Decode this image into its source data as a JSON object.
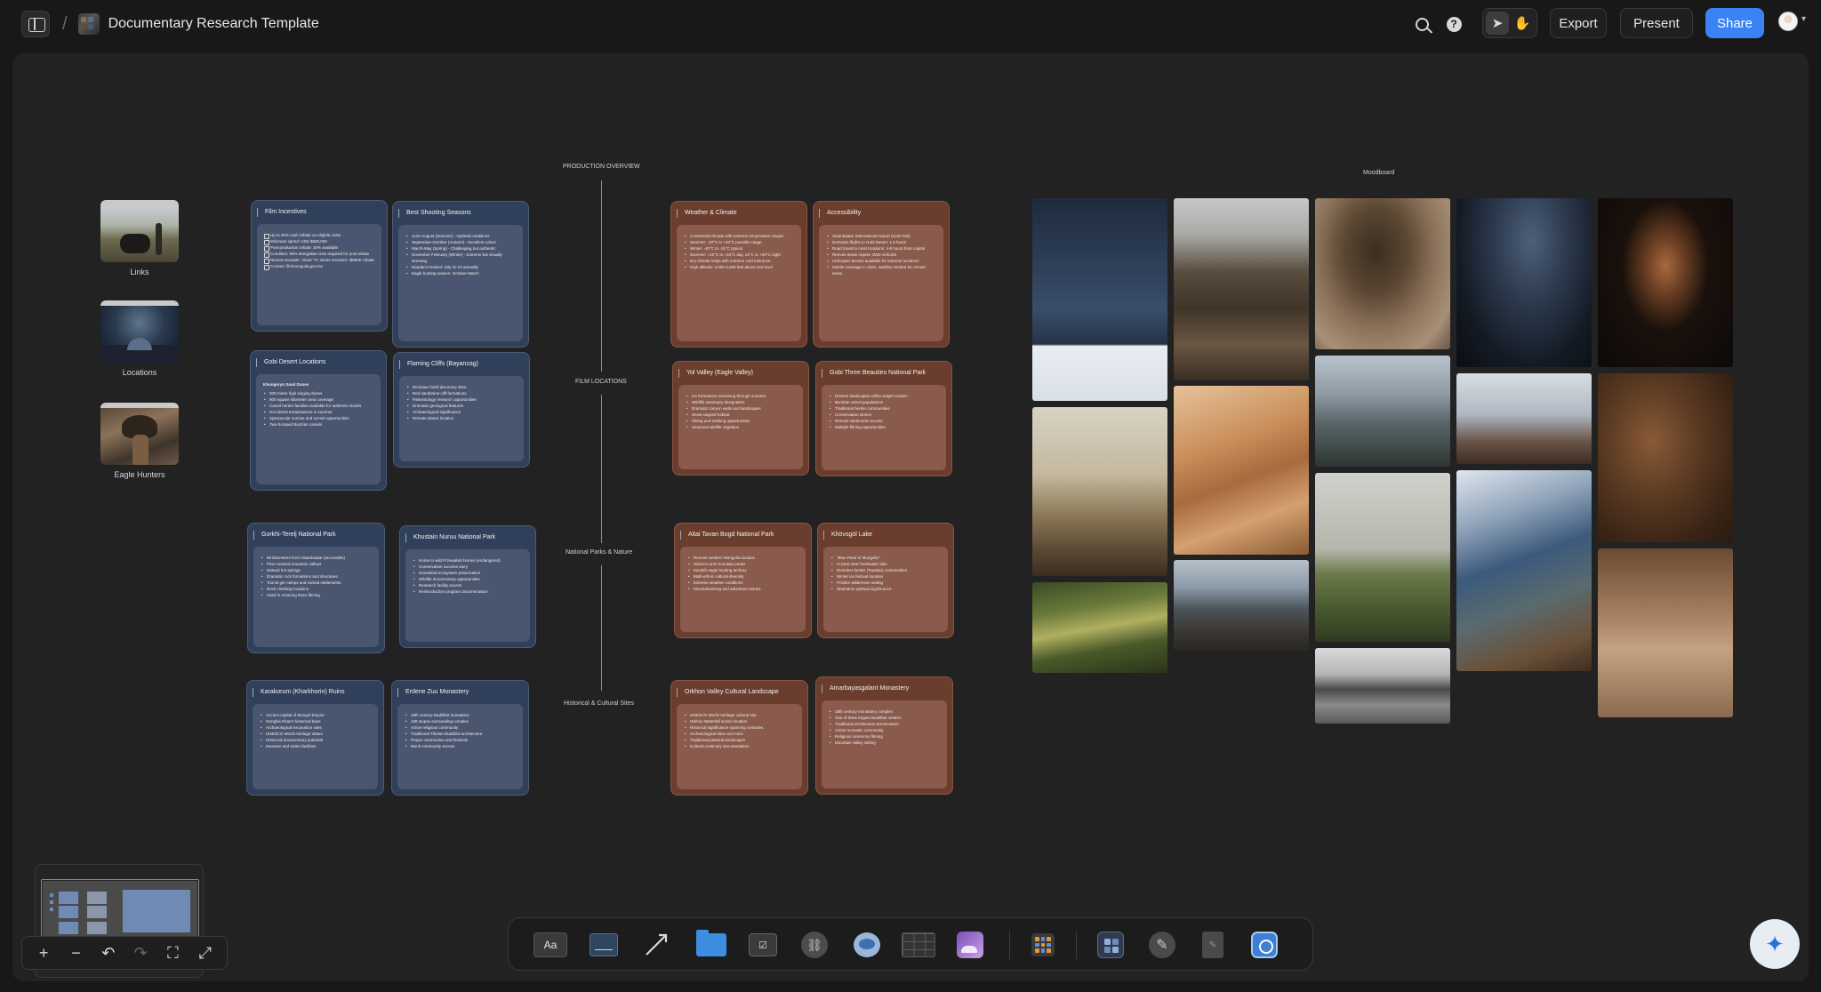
{
  "header": {
    "doc_title": "Documentary Research Template",
    "export_label": "Export",
    "present_label": "Present",
    "share_label": "Share"
  },
  "sections": {
    "production_overview": "PRODUCTION OVERVIEW",
    "film_locations": "FILM LOCATIONS",
    "national_parks": "National Parks & Nature",
    "historical_sites": "Historical & Cultural Sites",
    "moodboard": "Moodboard"
  },
  "folders": [
    {
      "label": "Links"
    },
    {
      "label": "Locations"
    },
    {
      "label": "Eagle Hunters"
    }
  ],
  "cards": {
    "film_incentives": {
      "title": "Film Incentives",
      "items": [
        "Up to 40% cash rebate on eligible costs",
        "Minimum spend: USD $500,000",
        "Post-production rebate: 30% available",
        "Condition: 50% Mongolian crew required for post rebate",
        "Recent example: 'Giant' TV series received ~$800K rebate",
        "Contact: filmmongolia.gov.mn"
      ]
    },
    "best_seasons": {
      "title": "Best Shooting Seasons",
      "items": [
        "June-August (Summer) - Optimal conditions",
        "September-October (Autumn) - Excellent colors",
        "March-May (Spring) - Challenging but authentic",
        "November-February (Winter) - Extreme but visually stunning",
        "Naadam Festival: July 11-13 annually",
        "Eagle hunting season: October-March"
      ]
    },
    "weather": {
      "title": "Weather & Climate",
      "items": [
        "Continental climate with extreme temperature ranges",
        "Summer: -40°C to +40°C possible range",
        "Winter: -40°C to -15°C typical",
        "Summer: +15°C to +34°C day, 14°C to +20°C night",
        "Dry climate helps with extreme cold tolerance",
        "High altitude: 2,000-4,000 feet above sea level"
      ]
    },
    "accessibility": {
      "title": "Accessibility",
      "items": [
        "Ulaanbaatar International Airport (main hub)",
        "Domestic flights to Gobi Desert: 1.5 hours",
        "Road travel to most locations: 4-8 hours from capital",
        "Remote areas require 4WD vehicles",
        "Helicopter access available for extreme locations",
        "Mobile coverage in cities, satellite needed for remote areas"
      ]
    },
    "gobi_locations": {
      "title": "Gobi Desert Locations",
      "subtitle": "Khongoryn Sand Dunes",
      "items": [
        "300-meter high singing dunes",
        "900 square kilometer area coverage",
        "Camel herder families available for authentic stories",
        "Hot desert temperatures in summer",
        "Spectacular sunrise and sunset opportunities",
        "Two-humped Bactrian camels"
      ]
    },
    "flaming_cliffs": {
      "title": "Flaming Cliffs (Bayanzag)",
      "items": [
        "Dinosaur fossil discovery sites",
        "Red sandstone cliff formations",
        "Paleontology research opportunities",
        "Dramatic geological features",
        "Archaeological significance",
        "Remote desert location"
      ]
    },
    "yol_valley": {
      "title": "Yol Valley (Eagle Valley)",
      "items": [
        "Ice formations remaining through summer",
        "Wildlife sanctuary designation",
        "Dramatic canyon walls and landscapes",
        "Snow-capped habitat",
        "Hiking and trekking opportunities",
        "Seasonal wildlife migration"
      ]
    },
    "gobi_three": {
      "title": "Gobi Three Beauties National Park",
      "items": [
        "Diverse landscapes within single location",
        "Bactrian camel populations",
        "Traditional herder communities",
        "Conservation stories",
        "Remote wilderness access",
        "Multiple filming opportunities"
      ]
    },
    "gorkhi": {
      "title": "Gorkhi-Terelj National Park",
      "items": [
        "80 kilometers from Ulaanbaatar (accessible)",
        "Pine-covered mountain valleys",
        "Natural hot springs",
        "Dramatic rock formations and structures",
        "Tourist ger camps and nomad settlements",
        "Rock climbing locations",
        "Used in Amazing Race filming"
      ]
    },
    "khustain": {
      "title": "Khustain Nuruu National Park",
      "items": [
        "Home to wild Przewalski horses (endangered)",
        "Conservation success story",
        "Grassland ecosystem preservation",
        "Wildlife documentary opportunities",
        "Research facility access",
        "Reintroduction program documentation"
      ]
    },
    "altai": {
      "title": "Altai Tavan Bogd National Park",
      "items": [
        "Remote western Mongolia location",
        "Glaciers and mountain peaks",
        "Kazakh eagle hunting territory",
        "Multi-ethnic cultural diversity",
        "Extreme weather conditions",
        "Mountaineering and adventure stories"
      ]
    },
    "khovsgol": {
      "title": "Khövsgöl Lake",
      "items": [
        "\"Blue Pearl of Mongolia\"",
        "Crystal clear freshwater lake",
        "Reindeer herder (Tsaatan) communities",
        "Winter ice festival location",
        "Pristine wilderness setting",
        "Shamanic spiritual significance"
      ]
    },
    "karakorum": {
      "title": "Karakorum (Kharkhorin) Ruins",
      "items": [
        "Ancient capital of Mongol Empire",
        "Genghis Khan's historical base",
        "Archaeological excavation sites",
        "UNESCO World Heritage status",
        "Historical documentary potential",
        "Museum and visitor facilities"
      ]
    },
    "erdene_zuu": {
      "title": "Erdene Zuu Monastery",
      "items": [
        "16th century Buddhist monastery",
        "108 stupas surrounding complex",
        "Active religious community",
        "Traditional Tibetan Buddhist architecture",
        "Prayer ceremonies and festivals",
        "Monk community access"
      ]
    },
    "orkhon": {
      "title": "Orkhon Valley Cultural Landscape",
      "items": [
        "UNESCO World Heritage cultural site",
        "Orkhon Waterfall scenic location",
        "Historical significance spanning centuries",
        "Archaeological sites and ruins",
        "Traditional pastoral landscapes",
        "Cultural continuity documentation"
      ]
    },
    "amarbayasgalant": {
      "title": "Amarbayasgalant Monastery",
      "items": [
        "18th century monastery complex",
        "One of three largest Buddhist centers",
        "Traditional architecture preservation",
        "Active monastic community",
        "Religious ceremony filming",
        "Mountain valley setting"
      ]
    }
  },
  "toolbar": {
    "text_tool_label": "Aa",
    "todo_label": "☑"
  },
  "icons": [
    "sidebar-toggle-icon",
    "search-icon",
    "help-icon",
    "select-arrow-icon",
    "hand-icon",
    "plus-icon",
    "minus-icon",
    "undo-icon",
    "redo-icon",
    "crop-icon",
    "fullscreen-icon",
    "sparkle-icon"
  ],
  "colors": {
    "share_button": "#3b82f6",
    "card_blue": "#31405a",
    "card_brown": "#6b3d2e",
    "canvas_bg": "#222222"
  }
}
